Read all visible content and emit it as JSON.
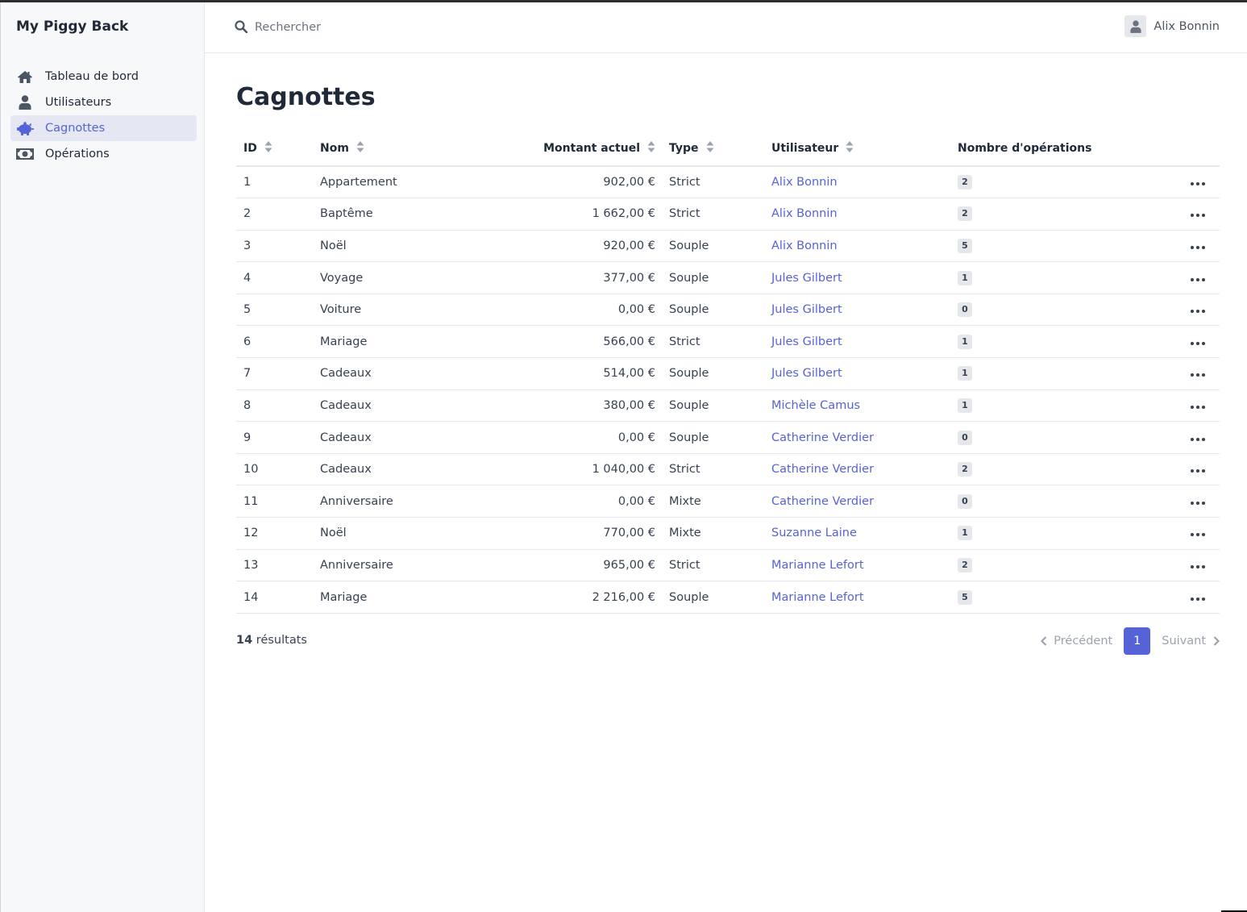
{
  "app": {
    "brand": "My Piggy Back"
  },
  "sidebar": {
    "items": [
      {
        "label": "Tableau de bord",
        "icon": "home-icon",
        "active": false
      },
      {
        "label": "Utilisateurs",
        "icon": "user-icon",
        "active": false
      },
      {
        "label": "Cagnottes",
        "icon": "piggy-bank-icon",
        "active": true
      },
      {
        "label": "Opérations",
        "icon": "money-bill-icon",
        "active": false
      }
    ]
  },
  "topbar": {
    "search": {
      "placeholder": "Rechercher",
      "value": ""
    },
    "user": {
      "name": "Alix Bonnin"
    }
  },
  "main": {
    "title": "Cagnottes",
    "table": {
      "columns": [
        "ID",
        "Nom",
        "Montant actuel",
        "Type",
        "Utilisateur",
        "Nombre d'opérations"
      ],
      "rows": [
        [
          "1",
          "Appartement",
          "902,00 €",
          "Strict",
          "Alix Bonnin",
          "2"
        ],
        [
          "2",
          "Baptême",
          "1 662,00 €",
          "Strict",
          "Alix Bonnin",
          "2"
        ],
        [
          "3",
          "Noël",
          "920,00 €",
          "Souple",
          "Alix Bonnin",
          "5"
        ],
        [
          "4",
          "Voyage",
          "377,00 €",
          "Souple",
          "Jules Gilbert",
          "1"
        ],
        [
          "5",
          "Voiture",
          "0,00 €",
          "Souple",
          "Jules Gilbert",
          "0"
        ],
        [
          "6",
          "Mariage",
          "566,00 €",
          "Strict",
          "Jules Gilbert",
          "1"
        ],
        [
          "7",
          "Cadeaux",
          "514,00 €",
          "Souple",
          "Jules Gilbert",
          "1"
        ],
        [
          "8",
          "Cadeaux",
          "380,00 €",
          "Souple",
          "Michèle Camus",
          "1"
        ],
        [
          "9",
          "Cadeaux",
          "0,00 €",
          "Souple",
          "Catherine Verdier",
          "0"
        ],
        [
          "10",
          "Cadeaux",
          "1 040,00 €",
          "Strict",
          "Catherine Verdier",
          "2"
        ],
        [
          "11",
          "Anniversaire",
          "0,00 €",
          "Mixte",
          "Catherine Verdier",
          "0"
        ],
        [
          "12",
          "Noël",
          "770,00 €",
          "Mixte",
          "Suzanne Laine",
          "1"
        ],
        [
          "13",
          "Anniversaire",
          "965,00 €",
          "Strict",
          "Marianne Lefort",
          "2"
        ],
        [
          "14",
          "Mariage",
          "2 216,00 €",
          "Souple",
          "Marianne Lefort",
          "5"
        ]
      ]
    },
    "footer": {
      "count": "14",
      "count_suffix": " résultats",
      "prev_label": "Précédent",
      "next_label": "Suivant",
      "current_page": "1"
    }
  },
  "colors": {
    "accent": "#5563d6",
    "sidebar_bg": "#f7f8fa",
    "badge_bg": "#e5e7eb"
  }
}
